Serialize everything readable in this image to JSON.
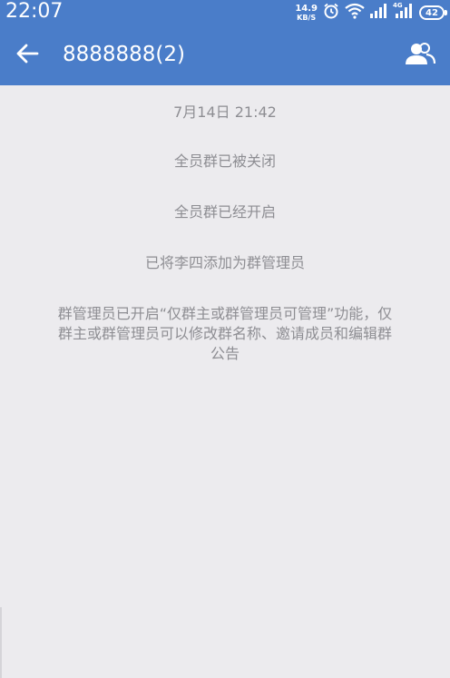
{
  "status_bar": {
    "time": "22:07",
    "net_speed_value": "14.9",
    "net_speed_unit": "KB/S",
    "network_type": "4G",
    "battery": "42"
  },
  "header": {
    "title": "8888888(2)"
  },
  "messages": {
    "timestamp": "7月14日  21:42",
    "items": [
      "全员群已被关闭",
      "全员群已经开启",
      "已将李四添加为群管理员"
    ],
    "notice_lines": [
      "群管理员已开启“仅群主或群管理员可管理”功能，仅",
      "群主或群管理员可以修改群名称、邀请成员和编辑群",
      "公告"
    ]
  },
  "colors": {
    "app_bar": "#4a7dc9",
    "background": "#ecebee",
    "system_text": "#8e8e93"
  }
}
